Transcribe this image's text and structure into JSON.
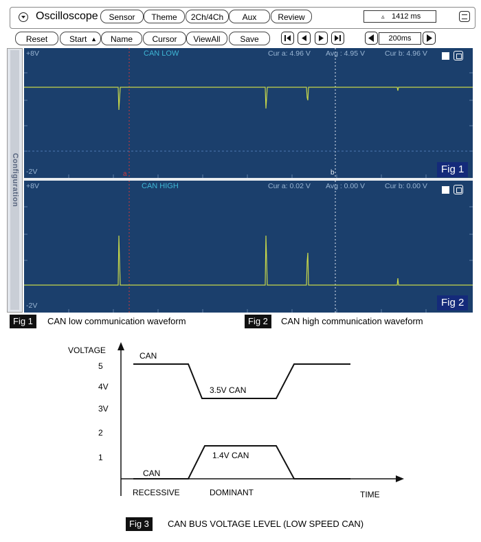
{
  "app": {
    "title": "Oscilloscope",
    "menu_icon": "chevron-down-circle-icon",
    "tabs": [
      "Sensor",
      "Theme",
      "2Ch/4Ch",
      "Aux",
      "Review"
    ],
    "time_readout": "1412 ms",
    "time_readout_icon": "delta-icon",
    "settings_icon": "list-icon"
  },
  "toolbar": {
    "reset": "Reset",
    "start": "Start",
    "name": "Name",
    "cursor": "Cursor",
    "viewall": "ViewAll",
    "save": "Save",
    "timebase": "200ms"
  },
  "sidebar": {
    "label": "Configuration"
  },
  "channels": [
    {
      "title": "CAN LOW",
      "vmax": "+8V",
      "vmin": "-2V",
      "cur_a": "Cur a: 4.96 V",
      "avg": "Avg  : 4.95 V",
      "cur_b": "Cur b: 4.96 V",
      "fig": "Fig 1",
      "trace_color": "#c8d84a"
    },
    {
      "title": "CAN HIGH",
      "vmax": "+8V",
      "vmin": "-2V",
      "cur_a": "Cur a: 0.02 V",
      "avg": "Avg  : 0.00 V",
      "cur_b": "Cur b: 0.00 V",
      "fig": "Fig 2",
      "trace_color": "#c8d84a"
    }
  ],
  "cursor_labels": {
    "a": "a",
    "b": "b"
  },
  "captions": [
    {
      "tag": "Fig 1",
      "text": "CAN low communication waveform"
    },
    {
      "tag": "Fig 2",
      "text": "CAN high communication waveform"
    }
  ],
  "diagram": {
    "ylabel": "VOLTAGE",
    "xlabel": "TIME",
    "ticks": [
      "5",
      "4V",
      "3V",
      "2",
      "1"
    ],
    "can_top": "CAN",
    "can_bottom": "CAN",
    "high_label": "3.5V   CAN",
    "low_label": "1.4V   CAN",
    "recessive": "RECESSIVE",
    "dominant": "DOMINANT",
    "caption_tag": "Fig 3",
    "caption": "CAN BUS VOLTAGE LEVEL (LOW SPEED CAN)"
  },
  "colors": {
    "panel_bg": "#1b3f6c",
    "cursor_a": "#d23a3a",
    "cursor_b": "#e8eef6",
    "fig_label_bg": "#142a7a"
  }
}
